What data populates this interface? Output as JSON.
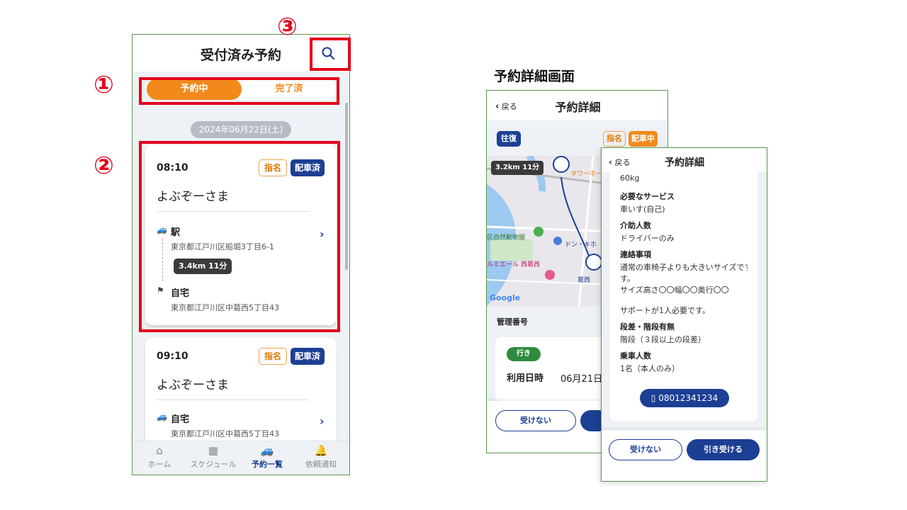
{
  "annotations": {
    "n1": "①",
    "n2": "②",
    "n3": "③"
  },
  "list_screen": {
    "title": "受付済み予約",
    "tabs": {
      "active": "予約中",
      "inactive": "完了済"
    },
    "date_chip": "2024年06月22日(土)",
    "cards": [
      {
        "time": "08:10",
        "tag_nominated": "指名",
        "tag_status": "配車済",
        "name": "よぶぞーさま",
        "from_name": "駅",
        "from_addr": "東京都江戸川区船堀3丁目6-1",
        "distance": "3.4km 11分",
        "to_name": "自宅",
        "to_addr": "東京都江戸川区中葛西5丁目43"
      },
      {
        "time": "09:10",
        "tag_nominated": "指名",
        "tag_status": "配車済",
        "name": "よぶぞーさま",
        "from_name": "自宅",
        "from_addr": "東京都江戸川区中葛西5丁目43"
      }
    ],
    "tabbar": [
      {
        "icon": "home-icon",
        "label": "ホーム"
      },
      {
        "icon": "calendar-icon",
        "label": "スケジュール"
      },
      {
        "icon": "car-icon",
        "label": "予約一覧"
      },
      {
        "icon": "bell-icon",
        "label": "依頼通知"
      }
    ],
    "colors": {
      "accent": "#f2891b",
      "primary": "#1c3f94",
      "annotation": "#e3001b"
    }
  },
  "detail_heading": "予約詳細画面",
  "detail_screen_1": {
    "back": "戻る",
    "title": "予約詳細",
    "trip_type": "往復",
    "tag_nominated": "指名",
    "tag_status": "配車中",
    "map_distance": "3.2km 11分",
    "map_labels": {
      "tower": "タワーホー",
      "zoo": "区自然動物園",
      "donki": "ドン・キホ",
      "lumiere": "ルミエール 西葛西",
      "kasai": "葛西",
      "google": "Google"
    },
    "mgmt_label": "管理番号",
    "direction": "行き",
    "date_label": "利用日時",
    "date_value": "06月21日",
    "reject": "受けない"
  },
  "detail_screen_2": {
    "back": "戻る",
    "title": "予約詳細",
    "weight": "60kg",
    "fields": [
      {
        "label": "必要なサービス",
        "value": "車いす(自己)"
      },
      {
        "label": "介助人数",
        "value": "ドライバーのみ"
      },
      {
        "label": "連絡事項",
        "value": "通常の車椅子よりも大きいサイズです。"
      },
      {
        "label": "段差・階段有無",
        "value": "階段（３段以上の段差）"
      },
      {
        "label": "乗車人数",
        "value": "1名（本人のみ）"
      }
    ],
    "note_line2": "す。",
    "note_line3": "サイズ高さ〇〇幅〇〇奥行〇〇",
    "note_line4": "サポートが1人必要です。",
    "phone": "08012341234",
    "reject": "受けない",
    "accept": "引き受ける"
  }
}
